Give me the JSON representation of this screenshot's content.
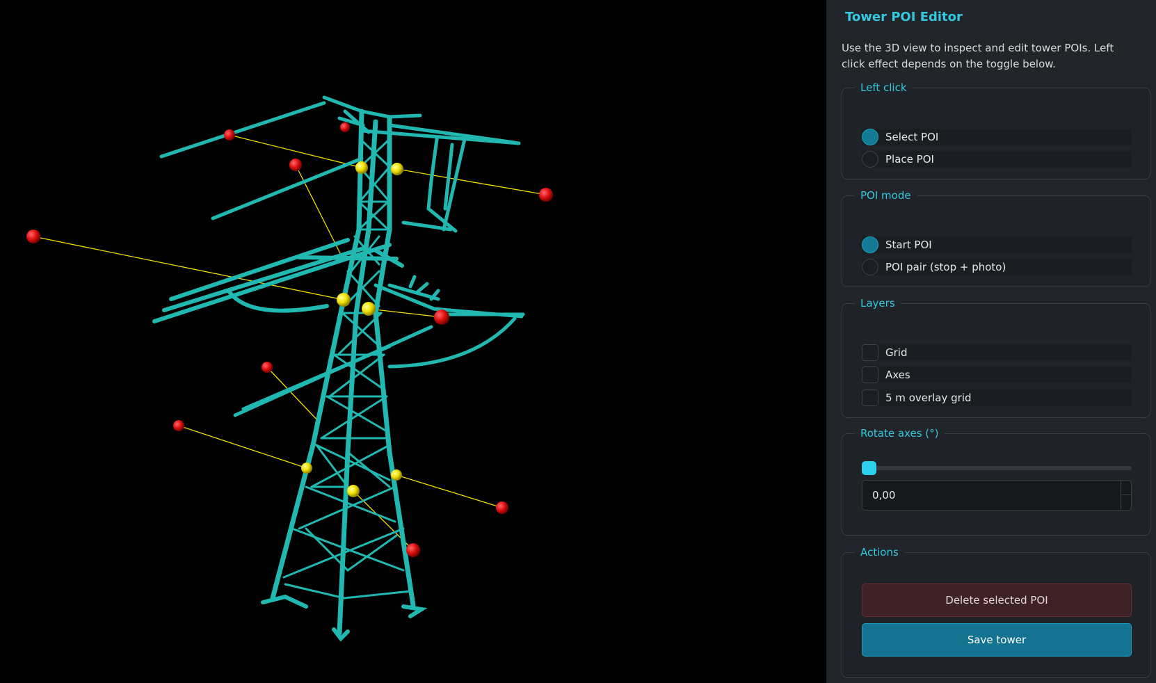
{
  "panel": {
    "title": "Tower POI Editor",
    "description": "Use the 3D view to inspect and edit tower POIs. Left click effect depends on the toggle below."
  },
  "left_click": {
    "legend": "Left click",
    "options": [
      {
        "label": "Select POI",
        "selected": true
      },
      {
        "label": "Place POI",
        "selected": false
      }
    ]
  },
  "poi_mode": {
    "legend": "POI mode",
    "options": [
      {
        "label": "Start POI",
        "selected": true
      },
      {
        "label": "POI pair (stop + photo)",
        "selected": false
      }
    ]
  },
  "layers": {
    "legend": "Layers",
    "options": [
      {
        "label": "Grid",
        "checked": false
      },
      {
        "label": "Axes",
        "checked": false
      },
      {
        "label": "5 m overlay grid",
        "checked": false
      }
    ]
  },
  "rotate_axes": {
    "legend": "Rotate axes (°)",
    "slider_fraction": 0,
    "value": "0,00"
  },
  "actions": {
    "legend": "Actions",
    "delete_label": "Delete selected POI",
    "save_label": "Save tower"
  },
  "colors": {
    "tower": "#20b8b0",
    "poi_red": "#e01010",
    "poi_yellow": "#f2e000",
    "accent": "#33c9e0"
  }
}
